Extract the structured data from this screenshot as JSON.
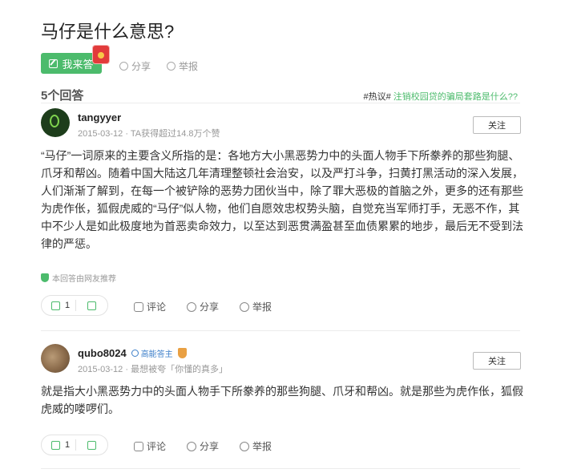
{
  "question": {
    "title": "马仔是什么意思?",
    "answer_label": "我来答",
    "share_label": "分享",
    "report_label": "举报"
  },
  "section": {
    "count_label": "5个回答",
    "hot_tag": "#热议#",
    "hot_link": "注销校园贷的骗局套路是什么??"
  },
  "answers": [
    {
      "username": "tangyyer",
      "date": "2015-03-12",
      "stat": "· TA获得超过14.8万个赞",
      "follow_label": "关注",
      "text": "“马仔”一词原来的主要含义所指的是：各地方大小黑恶势力中的头面人物手下所豢养的那些狗腿、爪牙和帮凶。随着中国大陆这几年清理整顿社会治安，以及严打斗争，扫黄打黑活动的深入发展，人们渐渐了解到，在每一个被铲除的恶势力团伙当中，除了罪大恶极的首脑之外，更多的还有那些为虎作伥，狐假虎威的“马仔”似人物，他们自愿效忠权势头脑，自觉充当军师打手，无恶不作，其中不少人是如此极度地为首恶卖命效力，以至达到恶贯满盈甚至血债累累的地步，最后无不受到法律的严惩。",
      "recommend": "本回答由网友推荐",
      "likes": "1",
      "comment_label": "评论",
      "share_label": "分享",
      "report_label": "举报"
    },
    {
      "username": "qubo8024",
      "rank_badge": "高能答主",
      "date": "2015-03-12",
      "stat": "· 最想被夸「你懂的真多」",
      "follow_label": "关注",
      "text": "就是指大小黑恶势力中的头面人物手下所豢养的那些狗腿、爪牙和帮凶。就是那些为虎作伥，狐假虎威的喽啰们。",
      "likes": "1",
      "comment_label": "评论",
      "share_label": "分享",
      "report_label": "举报"
    }
  ],
  "colors": {
    "accent": "#4cbb6c",
    "badge_blue": "#3d7fc9",
    "text": "#333333",
    "muted": "#999999"
  }
}
